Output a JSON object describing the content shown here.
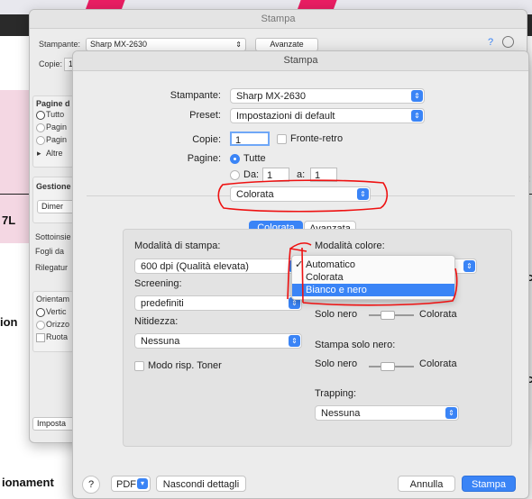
{
  "background": {
    "side_texts": [
      "7L",
      "ion",
      "ionament"
    ],
    "right_texts": [
      ":",
      "c",
      "c"
    ]
  },
  "back_window": {
    "title": "Stampa",
    "printer_label": "Stampante:",
    "printer_value": "Sharp MX-2630",
    "advanced_button": "Avanzate",
    "help_glyph": "?",
    "copies_label": "Copie:",
    "copies_value": "1",
    "pages_header": "Pagine d",
    "pages_options": [
      "Tutto",
      "Pagin",
      "Pagin"
    ],
    "other_label": "Altre",
    "management_header": "Gestione",
    "size_button": "Dimer",
    "subset_label": "Sottoinsie",
    "sheets_label": "Fogli da",
    "binding_label": "Rilegatur",
    "orientation_label": "Orientam",
    "orientation_options": [
      "Vertic",
      "Orizzo"
    ],
    "rotate_label": "Ruota",
    "setup_button": "Imposta"
  },
  "dialog": {
    "title": "Stampa",
    "printer_label": "Stampante:",
    "printer_value": "Sharp MX-2630",
    "preset_label": "Preset:",
    "preset_value": "Impostazioni di default",
    "copies_label": "Copie:",
    "copies_value": "1",
    "duplex_label": "Fronte-retro",
    "pages_label": "Pagine:",
    "pages_all": "Tutte",
    "pages_from_label": "Da:",
    "pages_from_value": "1",
    "pages_to_label": "a:",
    "pages_to_value": "1",
    "section_value": "Colorata",
    "tabs": [
      {
        "label": "Colorata",
        "active": true
      },
      {
        "label": "Avanzata",
        "active": false
      }
    ],
    "print_mode_label": "Modalità di stampa:",
    "print_mode_value": "600 dpi (Qualità elevata)",
    "screening_label": "Screening:",
    "screening_value": "predefiniti",
    "sharpness_label": "Nitidezza:",
    "sharpness_value": "Nessuna",
    "toner_save_label": "Modo risp. Toner",
    "color_mode_label": "Modalità colore:",
    "color_mode_menu": [
      {
        "label": "Automatico",
        "checked": true,
        "selected": false
      },
      {
        "label": "Colorata",
        "checked": false,
        "selected": false
      },
      {
        "label": "Bianco e nero",
        "checked": false,
        "selected": true
      }
    ],
    "slider1_left": "Solo nero",
    "slider1_right": "Colorata",
    "black_only_label": "Stampa solo nero:",
    "slider2_left": "Solo nero",
    "slider2_right": "Colorata",
    "trapping_label": "Trapping:",
    "trapping_value": "Nessuna",
    "help_button": "?",
    "pdf_button": "PDF",
    "hide_details_button": "Nascondi dettagli",
    "cancel_button": "Annulla",
    "print_button": "Stampa"
  },
  "colors": {
    "accent": "#3a84f6",
    "annotation": "#e11111",
    "background_brand": "#e91e63"
  }
}
